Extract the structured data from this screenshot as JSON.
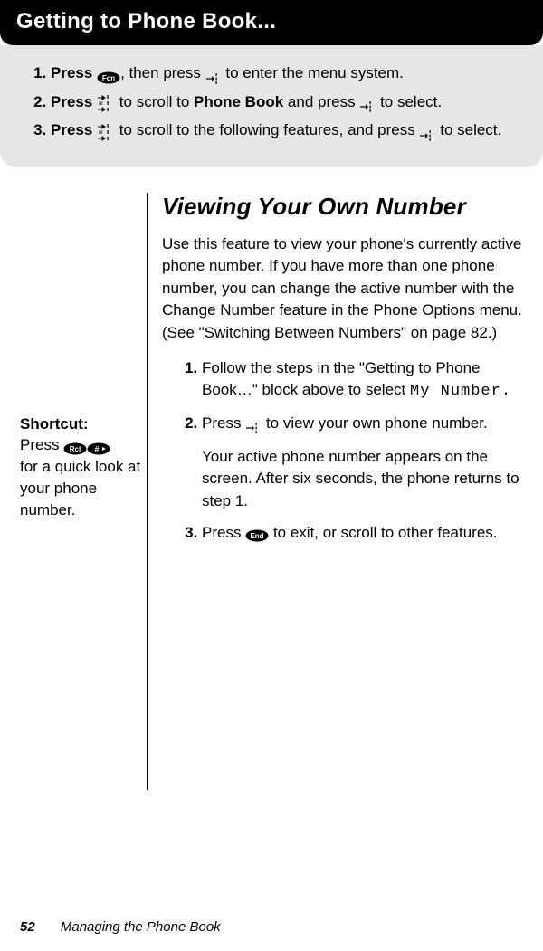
{
  "banner": {
    "title": "Getting to Phone Book..."
  },
  "intro": {
    "s1_a": "Press",
    "s1_b": ", then press",
    "s1_c": "to enter the menu system.",
    "s2_a": "Press",
    "s2_b": "to scroll to",
    "s2_c": "Phone Book",
    "s2_d": "and press",
    "s2_e": "to select.",
    "s3_a": "Press",
    "s3_b": "to scroll to the following features, and press",
    "s3_c": "to select."
  },
  "heading": "Viewing Your Own Number",
  "intro_para": "Use this feature to view your phone's currently active phone number. If you have more than one phone number, you can change the active number with the Change Number feature in the Phone Options menu. (See \"Switching Between Numbers\" on page 82.)",
  "sidebar": {
    "title": "Shortcut:",
    "line1": "Press ",
    "line2": "for a quick look at your phone number."
  },
  "steps": {
    "s1_a": "Follow the steps in the \"Getting to Phone Book…\" block above to select",
    "s1_b": "My Number.",
    "s2_a": "Press",
    "s2_b": "to view your own phone number.",
    "s2_sub": "Your active phone number appears on the screen. After six seconds, the phone returns to step 1.",
    "s3_a": "Press",
    "s3_b": "to exit, or scroll to other features."
  },
  "footer": {
    "page": "52",
    "title": "Managing the Phone Book"
  }
}
